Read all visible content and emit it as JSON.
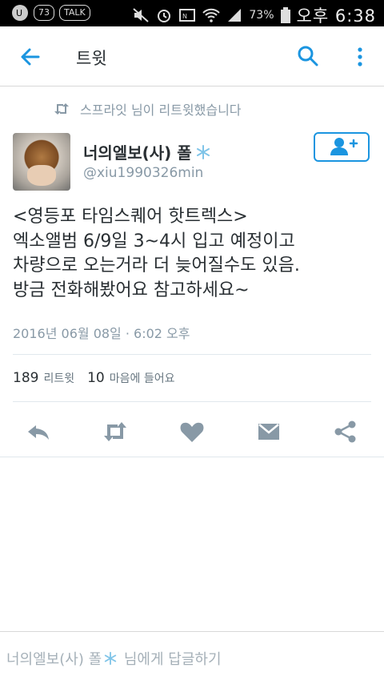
{
  "status_bar": {
    "badge_1": "73",
    "badge_2": "TALK",
    "battery": "73%",
    "time": "오후 6:38"
  },
  "app_bar": {
    "title": "트윗",
    "icons": {
      "back": "arrow-left-icon",
      "search": "search-icon",
      "more": "more-vert-icon"
    }
  },
  "tweet": {
    "retweeted_by": "스프라잇 님이 리트윗했습니다",
    "author_name": "너의엘보(사) 폴",
    "author_handle": "@xiu1990326min",
    "text_lines": [
      "<영등포 타임스퀘어 핫트렉스>",
      "엑소앨범 6/9일 3~4시 입고 예정이고",
      "차량으로 오는거라 더 늦어질수도 있음.",
      "방금 전화해봤어요 참고하세요~"
    ],
    "timestamp": "2016년 06월 08일 · 6:02 오후",
    "retweet_count": "189",
    "retweet_label": "리트윗",
    "like_count": "10",
    "like_label": "마음에 들어요"
  },
  "reply": {
    "prefix": "너의엘보(사) 폴",
    "suffix": " 님에게 답글하기"
  },
  "colors": {
    "accent": "#1b95e0",
    "muted": "#8899a6",
    "action": "#8899a6"
  }
}
